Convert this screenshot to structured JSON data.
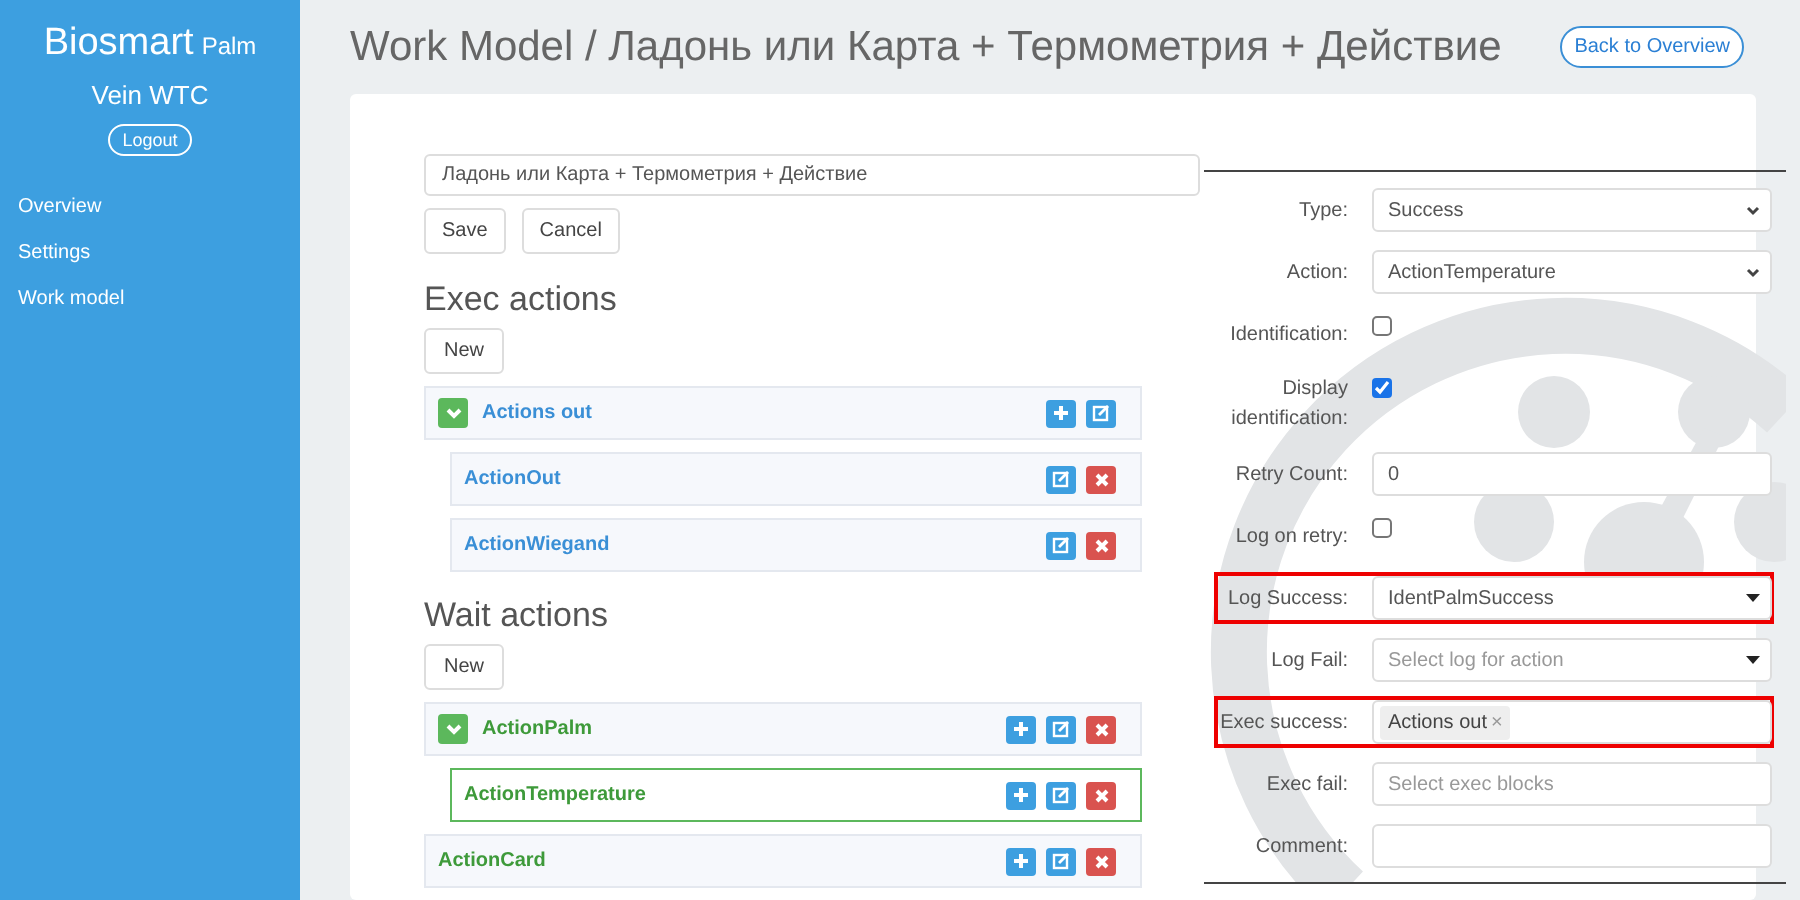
{
  "sidebar": {
    "brand": "Biosmart",
    "brand_suffix": "Palm",
    "subtitle": "Vein WTC",
    "logout": "Logout",
    "items": [
      {
        "label": "Overview"
      },
      {
        "label": "Settings"
      },
      {
        "label": "Work model"
      }
    ]
  },
  "header": {
    "title": "Work Model / Ладонь или Карта + Термометрия + Действие",
    "back_button": "Back to Overview"
  },
  "name_field": {
    "value": "Ладонь или Карта + Термометрия + Действие"
  },
  "form_buttons": [
    "Save",
    "Cancel"
  ],
  "sections": [
    {
      "kind": "exec",
      "heading": "Exec actions",
      "new_button": "New",
      "items": [
        {
          "label": "Actions out",
          "expanded": true,
          "selected": false,
          "buttons": [
            {
              "kind": "add"
            },
            {
              "kind": "edit"
            }
          ],
          "children": [
            {
              "label": "ActionOut",
              "selected": false,
              "buttons": [
                {
                  "kind": "edit"
                },
                {
                  "kind": "delete"
                }
              ]
            },
            {
              "label": "ActionWiegand",
              "selected": false,
              "buttons": [
                {
                  "kind": "edit"
                },
                {
                  "kind": "delete"
                }
              ]
            }
          ]
        }
      ]
    },
    {
      "kind": "wait",
      "heading": "Wait actions",
      "new_button": "New",
      "items": [
        {
          "label": "ActionPalm",
          "expanded": true,
          "selected": false,
          "buttons": [
            {
              "kind": "add"
            },
            {
              "kind": "edit"
            },
            {
              "kind": "delete"
            }
          ],
          "children": [
            {
              "label": "ActionTemperature",
              "selected": true,
              "buttons": [
                {
                  "kind": "add"
                },
                {
                  "kind": "edit"
                },
                {
                  "kind": "delete"
                }
              ]
            }
          ]
        },
        {
          "label": "ActionCard",
          "selected": false,
          "buttons": [
            {
              "kind": "add"
            },
            {
              "kind": "edit"
            },
            {
              "kind": "delete"
            }
          ]
        }
      ]
    }
  ],
  "properties": [
    {
      "label": "Type:",
      "kind": "select",
      "value": "Success",
      "highlighted": false
    },
    {
      "label": "Action:",
      "kind": "select",
      "value": "ActionTemperature",
      "highlighted": false
    },
    {
      "label": "Identification:",
      "kind": "checkbox",
      "checked": false,
      "highlighted": false
    },
    {
      "label": "Display identification:",
      "kind": "checkbox",
      "checked": true,
      "highlighted": false
    },
    {
      "label": "Retry Count:",
      "kind": "text",
      "value": "0",
      "highlighted": false
    },
    {
      "label": "Log on retry:",
      "kind": "checkbox",
      "checked": false,
      "highlighted": false
    },
    {
      "label": "Log Success:",
      "kind": "dropdown",
      "value": "IdentPalmSuccess",
      "highlighted": true
    },
    {
      "label": "Log Fail:",
      "kind": "dropdown",
      "placeholder": "Select log for action",
      "highlighted": false
    },
    {
      "label": "Exec success:",
      "kind": "tags",
      "tags": [
        {
          "label": "Actions out",
          "remove": "×"
        }
      ],
      "highlighted": true
    },
    {
      "label": "Exec fail:",
      "kind": "tags",
      "placeholder": "Select exec blocks",
      "highlighted": false
    },
    {
      "label": "Comment:",
      "kind": "text",
      "highlighted": false
    }
  ]
}
